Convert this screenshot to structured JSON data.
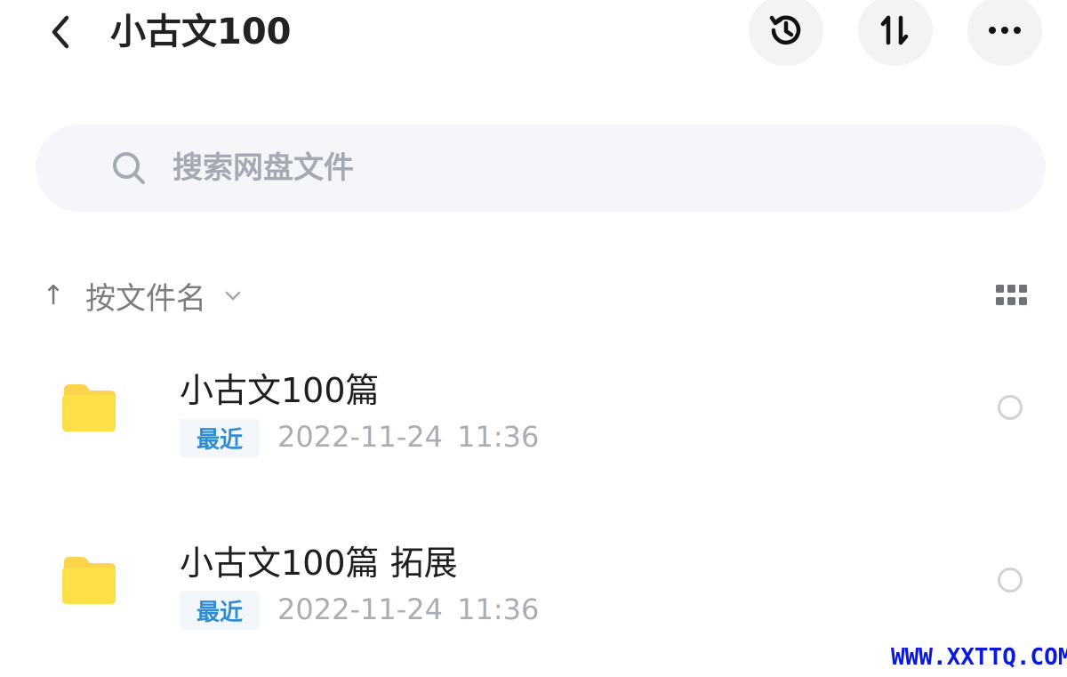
{
  "header": {
    "title": "小古文100",
    "back_icon": "chevron-left-icon",
    "actions": [
      {
        "name": "history",
        "icon": "history-icon"
      },
      {
        "name": "sort",
        "icon": "sort-updown-icon"
      },
      {
        "name": "more",
        "icon": "more-horizontal-icon"
      }
    ]
  },
  "search": {
    "placeholder": "搜索网盘文件",
    "value": "",
    "icon": "search-icon"
  },
  "sort": {
    "direction_icon": "arrow-up-icon",
    "direction_glyph": "↑",
    "label": "按文件名",
    "chevron_icon": "chevron-down-icon",
    "view_toggle_icon": "grid-view-icon"
  },
  "files": [
    {
      "name": "小古文100篇",
      "badge": "最近",
      "modified": "2022-11-24  11:36",
      "type": "folder",
      "selected": false
    },
    {
      "name": "小古文100篇 拓展",
      "badge": "最近",
      "modified": "2022-11-24  11:36",
      "type": "folder",
      "selected": false
    }
  ],
  "watermark": "WWW.XXTTQ.COM",
  "colors": {
    "folder": "#fcd34d",
    "badge_text": "#2f8dd6",
    "watermark": "#0a18e0",
    "button_bg": "#f2f3f5"
  }
}
